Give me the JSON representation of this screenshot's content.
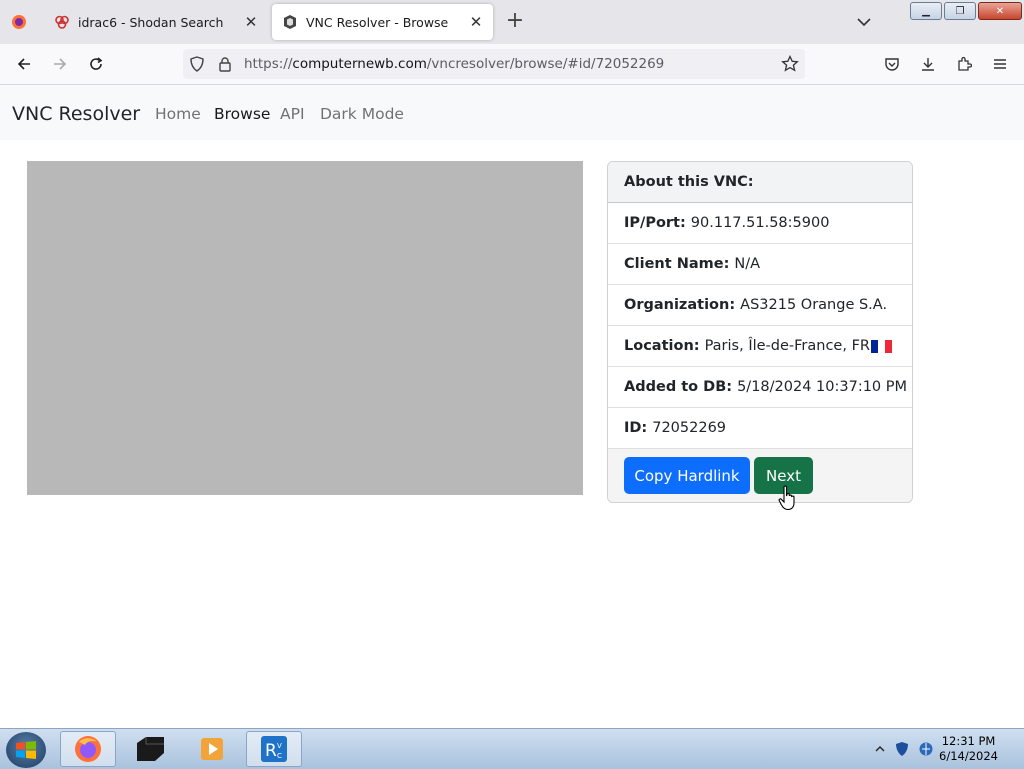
{
  "browser": {
    "tabs": [
      {
        "title": "idrac6 - Shodan Search",
        "icon": "shodan-icon",
        "active": false
      },
      {
        "title": "VNC Resolver - Browse",
        "icon": "vnc-resolver-icon",
        "active": true
      }
    ],
    "url_prefix": "https://",
    "url_host": "computernewb.com",
    "url_path": "/vncresolver/browse/#id/72052269"
  },
  "site": {
    "brand": "VNC Resolver",
    "nav": [
      "Home",
      "Browse",
      "API",
      "Dark Mode"
    ],
    "active_nav": "Browse"
  },
  "card": {
    "header": "About this VNC:",
    "rows": [
      {
        "label": "IP/Port:",
        "value": "90.117.51.58:5900"
      },
      {
        "label": "Client Name:",
        "value": "N/A"
      },
      {
        "label": "Organization:",
        "value": "AS3215 Orange S.A."
      },
      {
        "label": "Location:",
        "value": "Paris, Île-de-France, FR"
      },
      {
        "label": "Added to DB:",
        "value": "5/18/2024 10:37:10 PM"
      },
      {
        "label": "ID:",
        "value": "72052269"
      }
    ],
    "buttons": {
      "copy": "Copy Hardlink",
      "next": "Next"
    }
  },
  "taskbar": {
    "time": "12:31 PM",
    "date": "6/14/2024"
  },
  "colors": {
    "primary": "#0d6efd",
    "success": "#157347",
    "preview": "#b8b8b8",
    "flag_blue": "#002395",
    "flag_red": "#ed2939"
  }
}
